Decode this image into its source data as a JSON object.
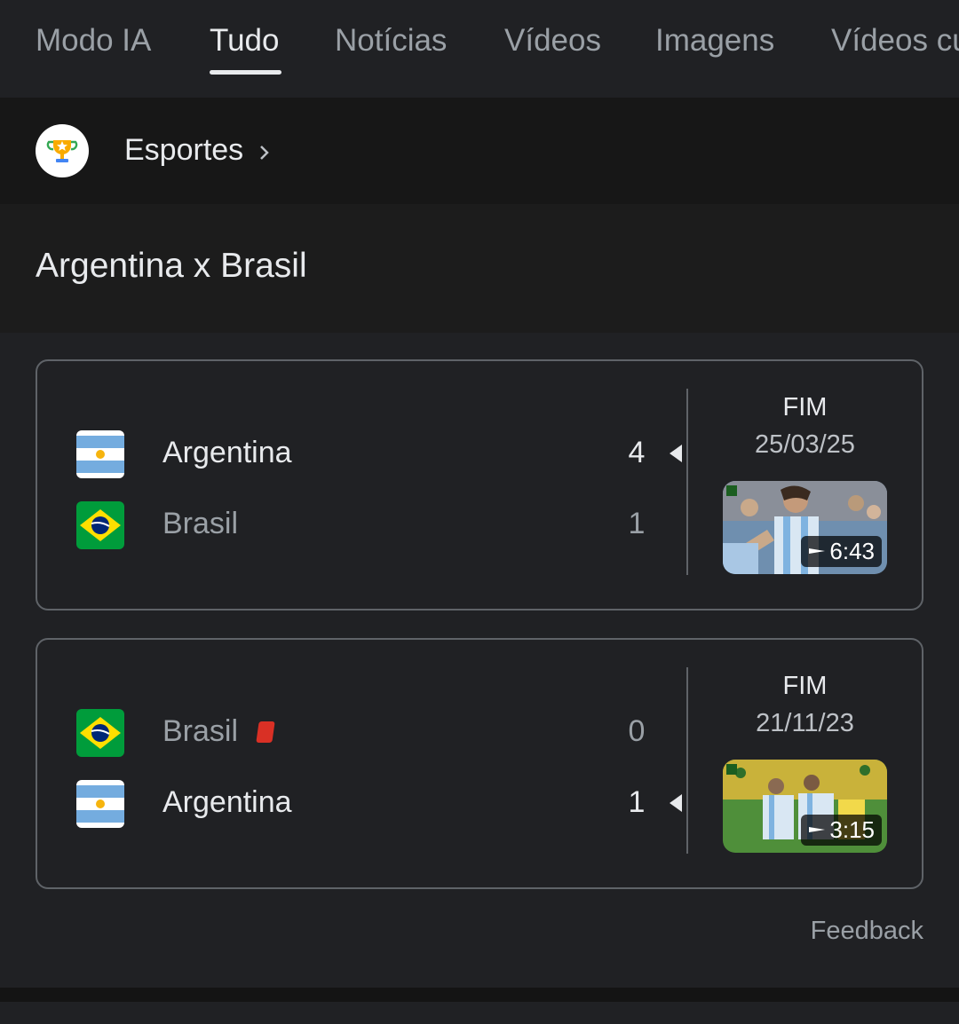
{
  "tabs": [
    {
      "label": "Modo IA"
    },
    {
      "label": "Tudo"
    },
    {
      "label": "Notícias"
    },
    {
      "label": "Vídeos"
    },
    {
      "label": "Imagens"
    },
    {
      "label": "Vídeos cu"
    }
  ],
  "active_tab": "Tudo",
  "sports": {
    "label": "Esportes",
    "icon": "trophy-icon"
  },
  "title": "Argentina x Brasil",
  "matches": [
    {
      "status": "FIM",
      "date": "25/03/25",
      "teams": [
        {
          "name": "Argentina",
          "score": "4",
          "winner": true,
          "flag": "argentina-flag"
        },
        {
          "name": "Brasil",
          "score": "1",
          "winner": false,
          "flag": "brazil-flag"
        }
      ],
      "video_duration": "6:43"
    },
    {
      "status": "FIM",
      "date": "21/11/23",
      "teams": [
        {
          "name": "Brasil",
          "score": "0",
          "winner": false,
          "flag": "brazil-flag",
          "red_card": true
        },
        {
          "name": "Argentina",
          "score": "1",
          "winner": true,
          "flag": "argentina-flag"
        }
      ],
      "video_duration": "3:15"
    }
  ],
  "feedback_label": "Feedback",
  "colors": {
    "background": "#202124",
    "text_primary": "#e8eaed",
    "text_secondary": "#9aa0a6",
    "border": "#5f6368",
    "red_card": "#d93025"
  }
}
